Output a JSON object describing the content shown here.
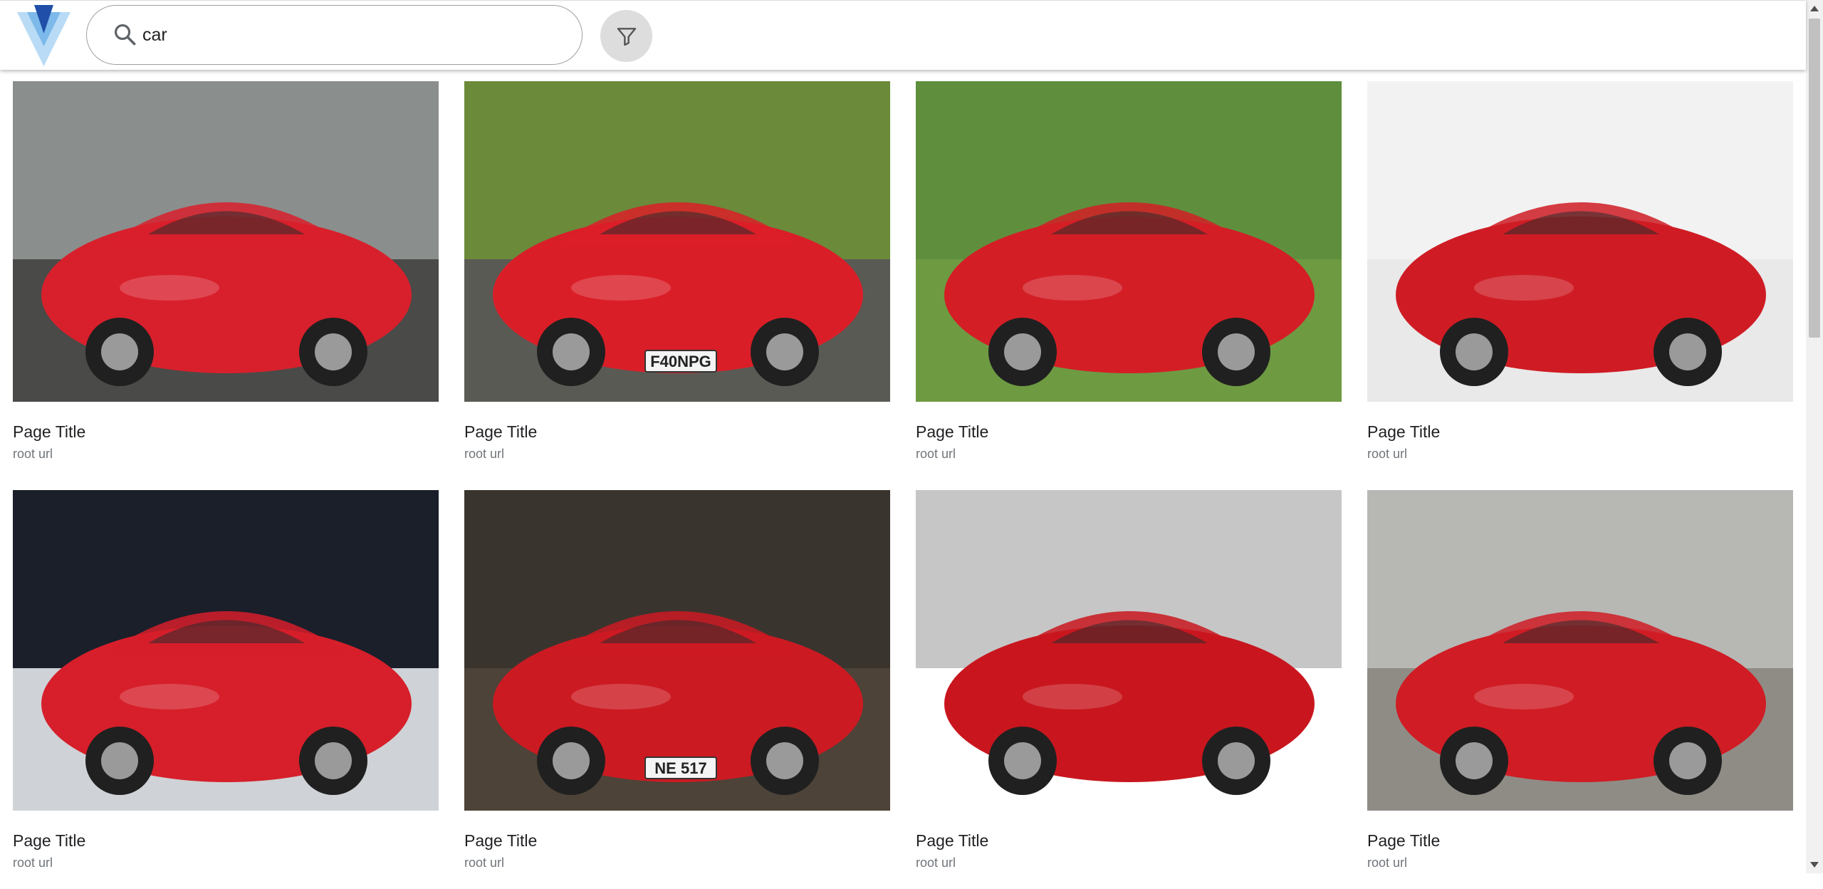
{
  "header": {
    "logo_icon": "v-logo-icon",
    "search": {
      "value": "car",
      "icon": "search-icon"
    },
    "filter_icon": "filter-icon"
  },
  "results": [
    {
      "title": "Page Title",
      "url": "root url",
      "image": "red roadster in museum display",
      "car_color": "#d8202c",
      "bg": "#8a8e8c",
      "floor": "#4a4a48",
      "plate": ""
    },
    {
      "title": "Page Title",
      "url": "root url",
      "image": "red supercar front view",
      "car_color": "#da1e28",
      "bg": "#6b8a3a",
      "floor": "#5a5a55",
      "plate": "F40NPG"
    },
    {
      "title": "Page Title",
      "url": "root url",
      "image": "red coupe with open hood on grass",
      "car_color": "#d41e26",
      "bg": "#5f8f3d",
      "floor": "#6e9a42",
      "plate": ""
    },
    {
      "title": "Page Title",
      "url": "root url",
      "image": "red concept sports car render",
      "car_color": "#cf1c24",
      "bg": "#f2f2f2",
      "floor": "#e9e9e9",
      "plate": ""
    },
    {
      "title": "Page Title",
      "url": "root url",
      "image": "red sports car with black stripes at auto show",
      "car_color": "#d61f2a",
      "bg": "#1a1f2a",
      "floor": "#cfd2d6",
      "plate": ""
    },
    {
      "title": "Page Title",
      "url": "root url",
      "image": "red vintage convertible in showroom",
      "car_color": "#cc1a22",
      "bg": "#3a342e",
      "floor": "#4d4338",
      "plate": "NE 517"
    },
    {
      "title": "Page Title",
      "url": "root url",
      "image": "red car side profile close-up",
      "car_color": "#c9161e",
      "bg": "#c6c6c6",
      "floor": "#ffffff",
      "plate": ""
    },
    {
      "title": "Page Title",
      "url": "root url",
      "image": "red vintage roadster on display",
      "car_color": "#d01c24",
      "bg": "#b7b7b4",
      "floor": "#8f8c86",
      "plate": ""
    }
  ]
}
